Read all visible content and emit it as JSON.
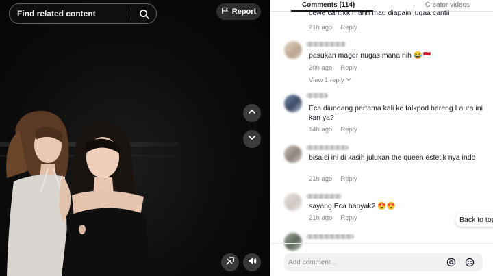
{
  "video": {
    "search": {
      "label": "Find related content"
    },
    "report_label": "Report"
  },
  "comments_panel": {
    "tabs": [
      {
        "label": "Comments (114)"
      },
      {
        "label": "Creator videos"
      }
    ],
    "comments": [
      {
        "text": "cewe cantikk mahh mau diapain jugaa cantii",
        "time": "21h ago",
        "reply_label": "Reply"
      },
      {
        "text": "pasukan mager nugas mana nih 😂🇲🇨",
        "time": "20h ago",
        "reply_label": "Reply",
        "view_replies": "View 1 reply"
      },
      {
        "text": "Eca diundang pertama kali ke talkpod bareng Laura ini kan ya?",
        "time": "14h ago",
        "reply_label": "Reply"
      },
      {
        "text": "bisa si ini di kasih julukan the queen estetik nya indo",
        "time": "21h ago",
        "reply_label": "Reply"
      },
      {
        "text": "sayang Eca banyak2 😍😍",
        "time": "21h ago",
        "reply_label": "Reply"
      }
    ],
    "back_to_top": "Back to top",
    "input": {
      "placeholder": "Add comment..."
    }
  },
  "icons": {
    "search": "search-icon",
    "report": "flag-icon",
    "up": "chevron-up-icon",
    "down": "chevron-down-icon",
    "float": "pip-icon",
    "volume": "volume-icon",
    "mention": "at-icon",
    "emoji": "emoji-icon"
  }
}
